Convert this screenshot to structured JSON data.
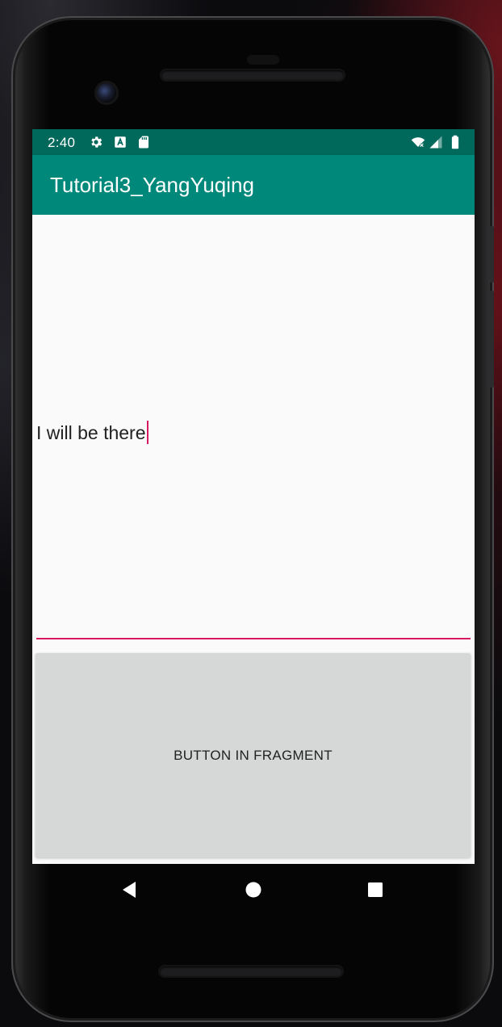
{
  "status_bar": {
    "time": "2:40",
    "icons": [
      "settings-icon",
      "a-notification-icon",
      "sd-card-icon",
      "wifi-icon",
      "signal-icon",
      "battery-icon"
    ]
  },
  "app_bar": {
    "title": "Tutorial3_YangYuqing"
  },
  "edit_text": {
    "value": "I will be there"
  },
  "fragment_button": {
    "label": "BUTTON IN FRAGMENT"
  },
  "nav_bar": {
    "buttons": [
      "back-icon",
      "home-icon",
      "overview-icon"
    ]
  },
  "colors": {
    "status_bar": "#00695c",
    "app_bar": "#00897b",
    "accent": "#d81b60",
    "background": "#fafafa",
    "button": "#d6d7d7"
  }
}
